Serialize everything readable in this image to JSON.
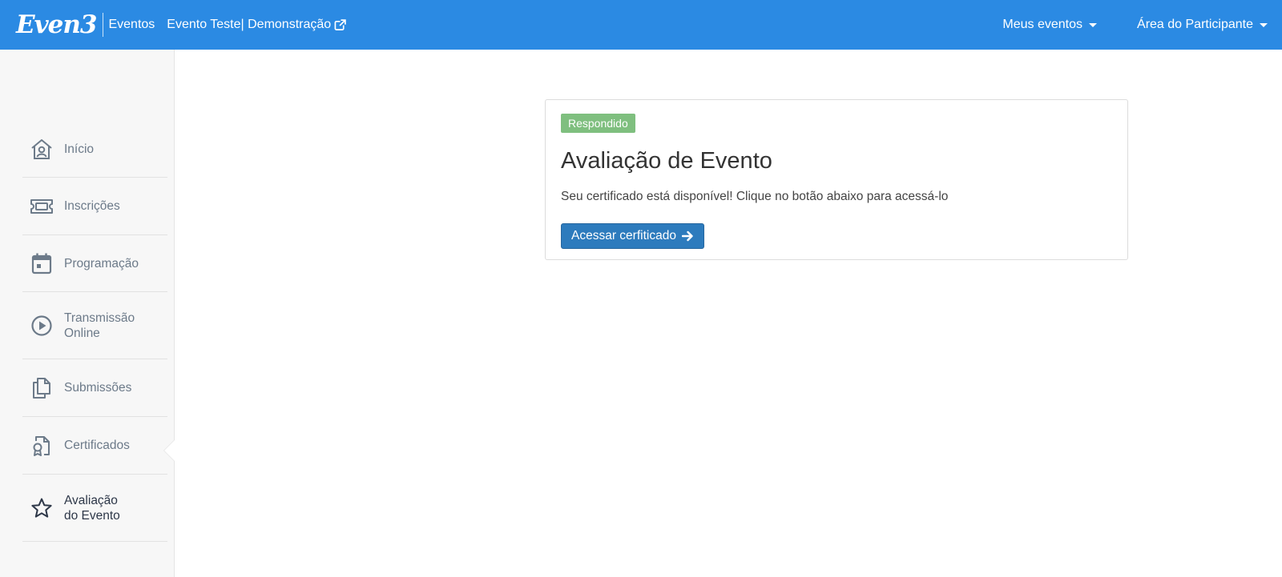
{
  "header": {
    "logo_text": "Even3",
    "brand_sub": "Eventos",
    "event_link": "Evento Teste| Demonstração",
    "menus": [
      {
        "label": "Meus eventos"
      },
      {
        "label": "Área do Participante"
      }
    ]
  },
  "sidebar": {
    "items": [
      {
        "label": "Início",
        "icon": "home-user-icon"
      },
      {
        "label": "Inscrições",
        "icon": "ticket-icon"
      },
      {
        "label": "Programação",
        "icon": "calendar-icon"
      },
      {
        "label_line1": "Transmissão",
        "label_line2": "Online",
        "icon": "play-circle-icon"
      },
      {
        "label": "Submissões",
        "icon": "copy-documents-icon"
      },
      {
        "label": "Certificados",
        "icon": "certificate-icon"
      },
      {
        "label_line1": "Avaliação",
        "label_line2": "do Evento",
        "icon": "star-icon",
        "active": true
      }
    ]
  },
  "card": {
    "badge": "Respondido",
    "title": "Avaliação de Evento",
    "text": "Seu certificado está disponível! Clique no botão abaixo para acessá-lo",
    "button": "Acessar cerfiticado"
  },
  "colors": {
    "topbar": "#2b8ae3",
    "badge": "#7fbf7f",
    "button": "#2d7bbd"
  }
}
